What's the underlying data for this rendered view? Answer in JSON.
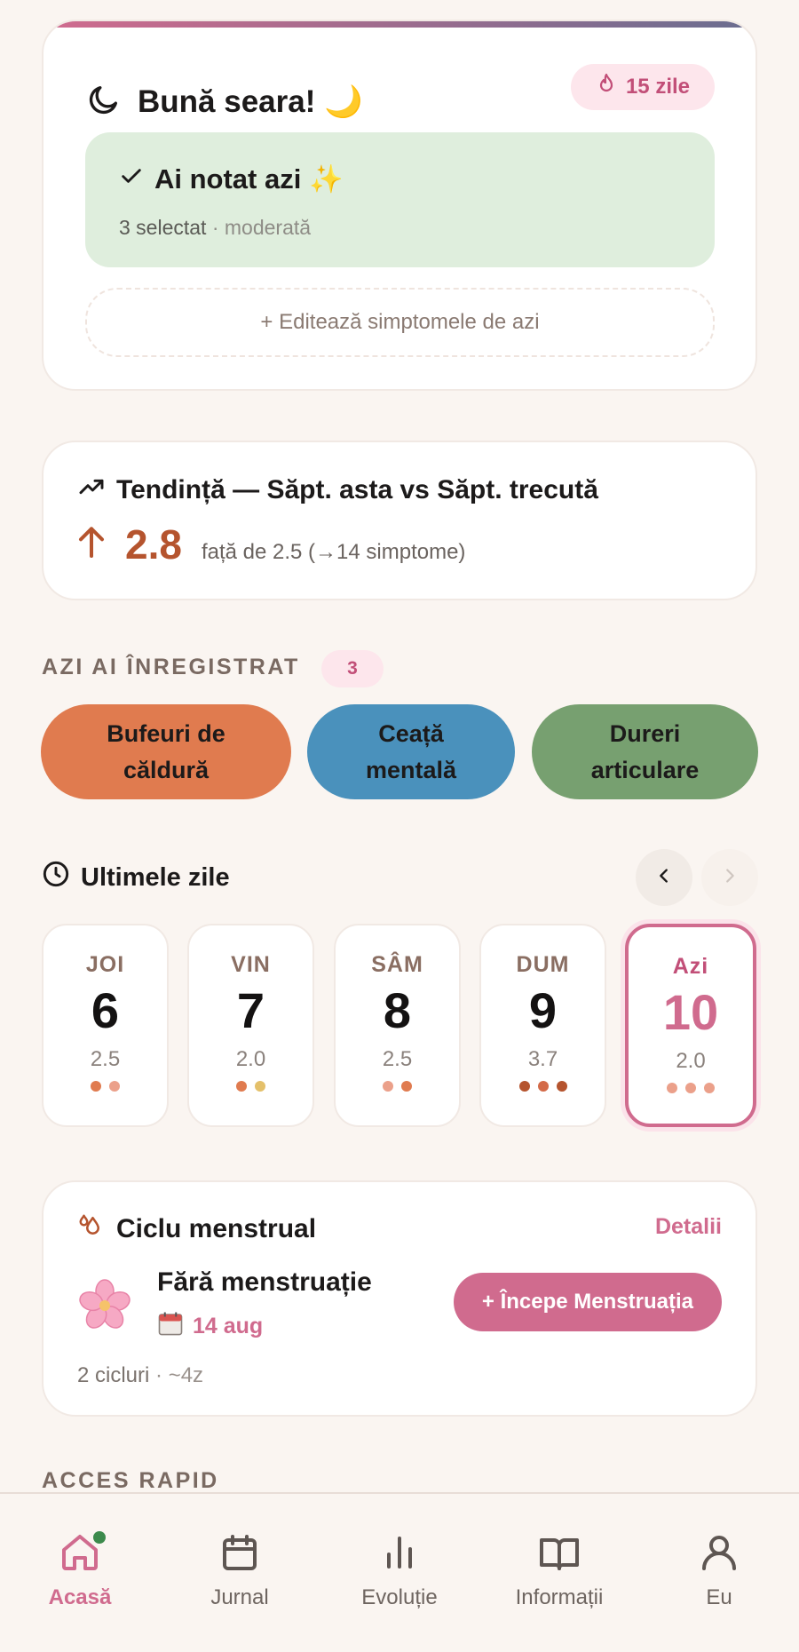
{
  "greeting": {
    "title": "Bună seara! 🌙",
    "streak": "15 zile",
    "logged_title": "Ai notat azi ✨",
    "logged_count": "3 selectat",
    "logged_severity": "· moderată",
    "edit_label": "+ Editează simptomele de azi"
  },
  "trend": {
    "title": "Tendință — Săpt. asta vs Săpt. trecută",
    "value": "2.8",
    "comparison": "față de 2.5 (→14 simptome)"
  },
  "today_logged": {
    "title": "AZI AI ÎNREGISTRAT",
    "count": "3",
    "chips": [
      {
        "line1": "Bufeuri de",
        "line2": "căldură",
        "color": "#e07b4f"
      },
      {
        "line1": "Ceață",
        "line2": "mentală",
        "color": "#4a91bc"
      },
      {
        "line1": "Dureri",
        "line2": "articulare",
        "color": "#77a070"
      }
    ]
  },
  "last_days": {
    "title": "Ultimele zile",
    "days": [
      {
        "name": "JOI",
        "date": "6",
        "score": "2.5",
        "dots": [
          "#e07b4f",
          "#eba08a"
        ]
      },
      {
        "name": "VIN",
        "date": "7",
        "score": "2.0",
        "dots": [
          "#e07b4f",
          "#e4c06a"
        ]
      },
      {
        "name": "SÂM",
        "date": "8",
        "score": "2.5",
        "dots": [
          "#eba08a",
          "#e07b4f"
        ]
      },
      {
        "name": "DUM",
        "date": "9",
        "score": "3.7",
        "dots": [
          "#b5542e",
          "#d36a48",
          "#b5542e"
        ]
      },
      {
        "name": "Azi",
        "date": "10",
        "score": "2.0",
        "dots": [
          "#eba08a",
          "#eba08a",
          "#eba08a"
        ]
      }
    ]
  },
  "cycle": {
    "title": "Ciclu menstrual",
    "details": "Detalii",
    "status": "Fără menstruație",
    "date": "14 aug",
    "start_button": "+ Începe Menstruația",
    "cycles": "2 cicluri",
    "avg": "· ~4z"
  },
  "quick_access": {
    "title": "ACCES RAPID"
  },
  "nav": {
    "items": [
      {
        "label": "Acasă",
        "icon": "home-icon"
      },
      {
        "label": "Jurnal",
        "icon": "calendar-icon"
      },
      {
        "label": "Evoluție",
        "icon": "bar-chart-icon"
      },
      {
        "label": "Informații",
        "icon": "book-icon"
      },
      {
        "label": "Eu",
        "icon": "user-icon"
      }
    ]
  },
  "colors": {
    "accent": "#d06b8e",
    "trend": "#b5542e",
    "logged_bg": "#dfeedd"
  }
}
